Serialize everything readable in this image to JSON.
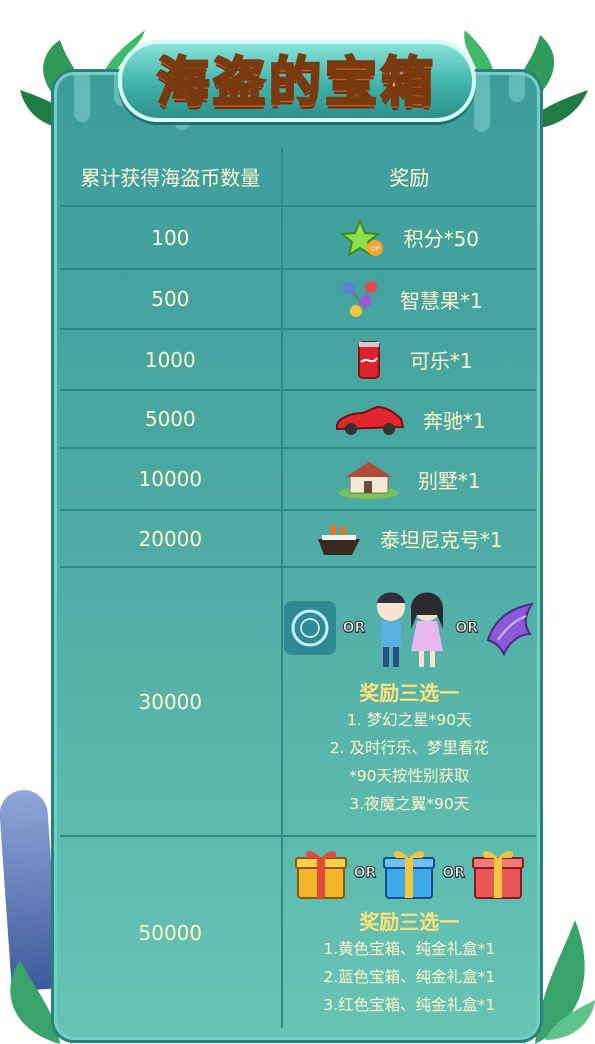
{
  "title": "海盗的宝箱",
  "table": {
    "headers": {
      "count": "累计获得海盗币数量",
      "reward": "奖励"
    },
    "rows": [
      {
        "count": "100",
        "reward": "积分*50",
        "icon": "star-up-icon"
      },
      {
        "count": "500",
        "reward": "智慧果*1",
        "icon": "candy-fruit-icon"
      },
      {
        "count": "1000",
        "reward": "可乐*1",
        "icon": "cola-can-icon"
      },
      {
        "count": "5000",
        "reward": "奔驰*1",
        "icon": "red-car-icon"
      },
      {
        "count": "10000",
        "reward": "别墅*1",
        "icon": "villa-icon"
      },
      {
        "count": "20000",
        "reward": "泰坦尼克号*1",
        "icon": "ship-icon"
      }
    ],
    "big_rows": [
      {
        "count": "30000",
        "options_icons": [
          "dream-star-icon",
          "couple-avatar-icon",
          "night-wing-icon"
        ],
        "or_label": "OR",
        "subtitle": "奖励三选一",
        "lines": [
          "1. 梦幻之星*90天",
          "2. 及时行乐、梦里看花",
          "*90天按性别获取",
          "3.夜魔之翼*90天"
        ]
      },
      {
        "count": "50000",
        "options_icons": [
          "yellow-gift-icon",
          "blue-gift-icon",
          "red-gift-icon"
        ],
        "or_label": "OR",
        "subtitle": "奖励三选一",
        "lines": [
          "1.黄色宝箱、纯金礼盒*1",
          "2.蓝色宝箱、纯金礼盒*1",
          "3.红色宝箱、纯金礼盒*1"
        ]
      }
    ]
  }
}
